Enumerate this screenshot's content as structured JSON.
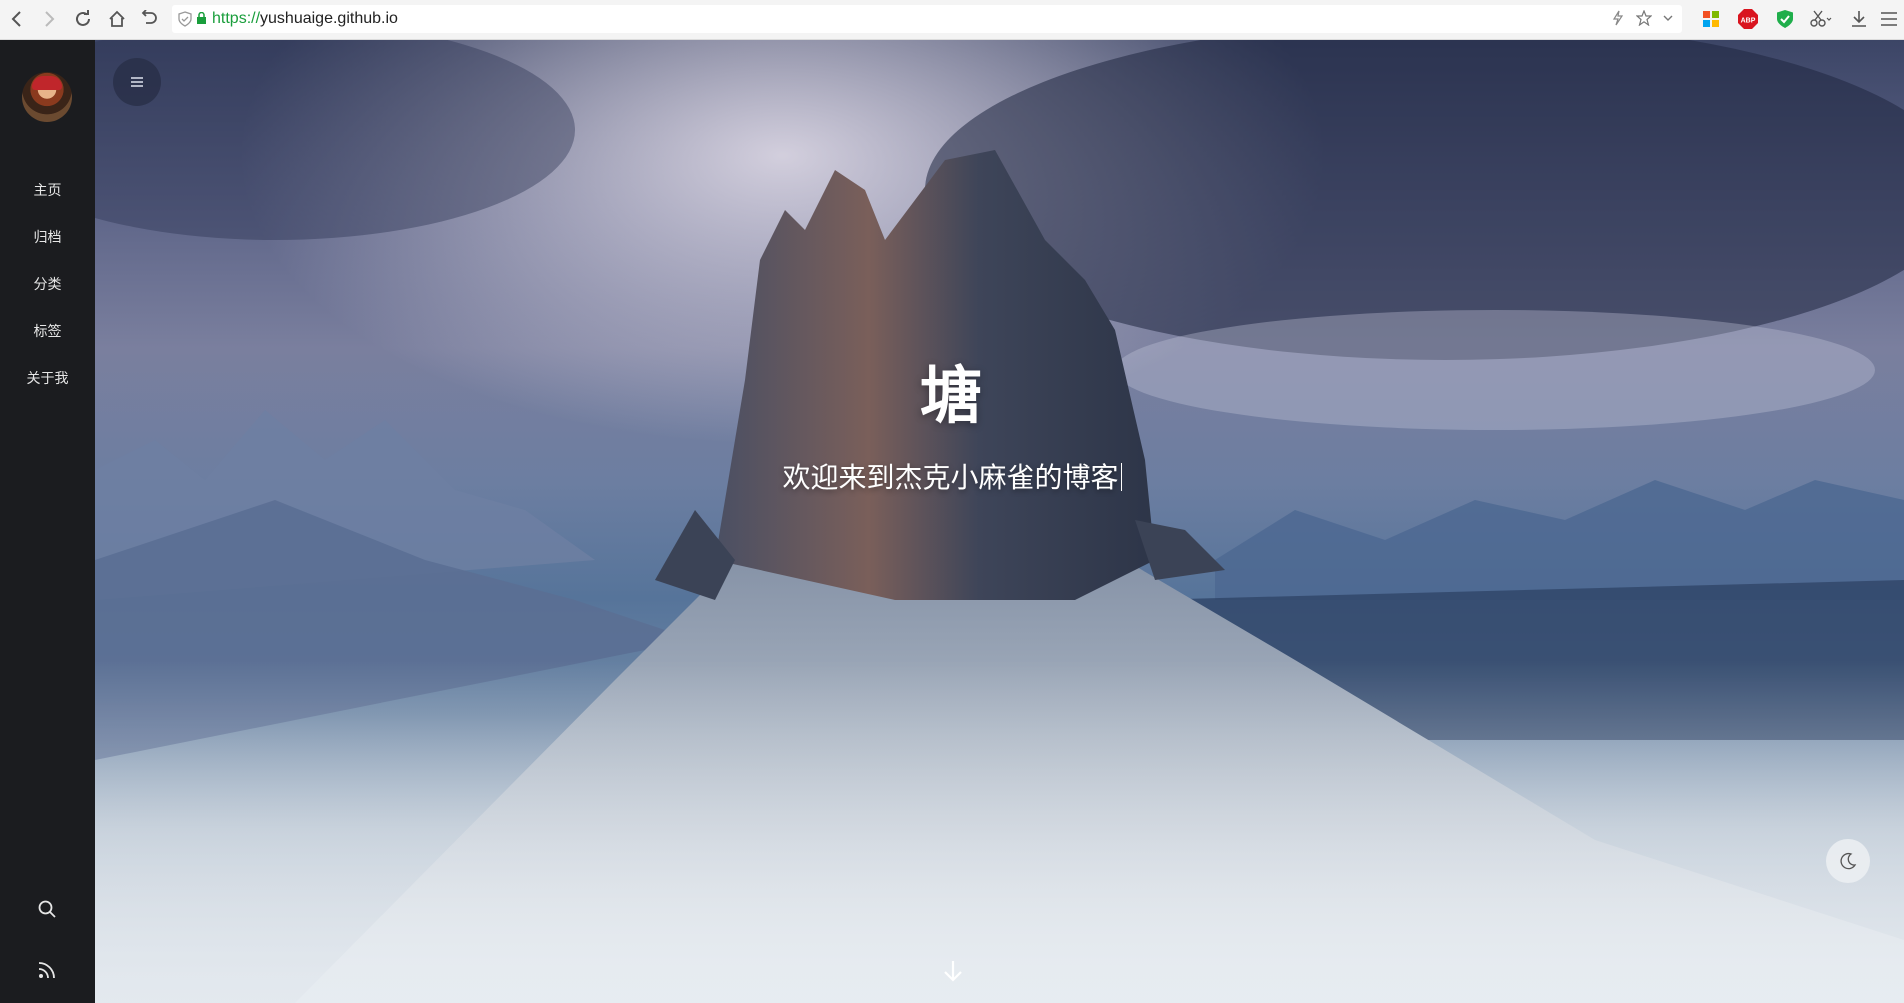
{
  "browser": {
    "url_scheme": "https://",
    "url_host": "yushuaige.github.io",
    "extensions": [
      "windows-grid-icon",
      "adblock-plus-icon",
      "shield-check-icon",
      "scissors-icon",
      "download-icon",
      "menu-lines-icon"
    ],
    "extension_labels": {
      "adblock": "ABP"
    }
  },
  "sidebar": {
    "items": [
      {
        "label": "主页"
      },
      {
        "label": "归档"
      },
      {
        "label": "分类"
      },
      {
        "label": "标签"
      },
      {
        "label": "关于我"
      }
    ]
  },
  "hero": {
    "title": "塘",
    "subtitle": "欢迎来到杰克小麻雀的博客"
  },
  "colors": {
    "sidebar_bg": "#1b1c1f",
    "url_scheme": "#1a9e3c",
    "menu_button_bg": "#282e46"
  }
}
